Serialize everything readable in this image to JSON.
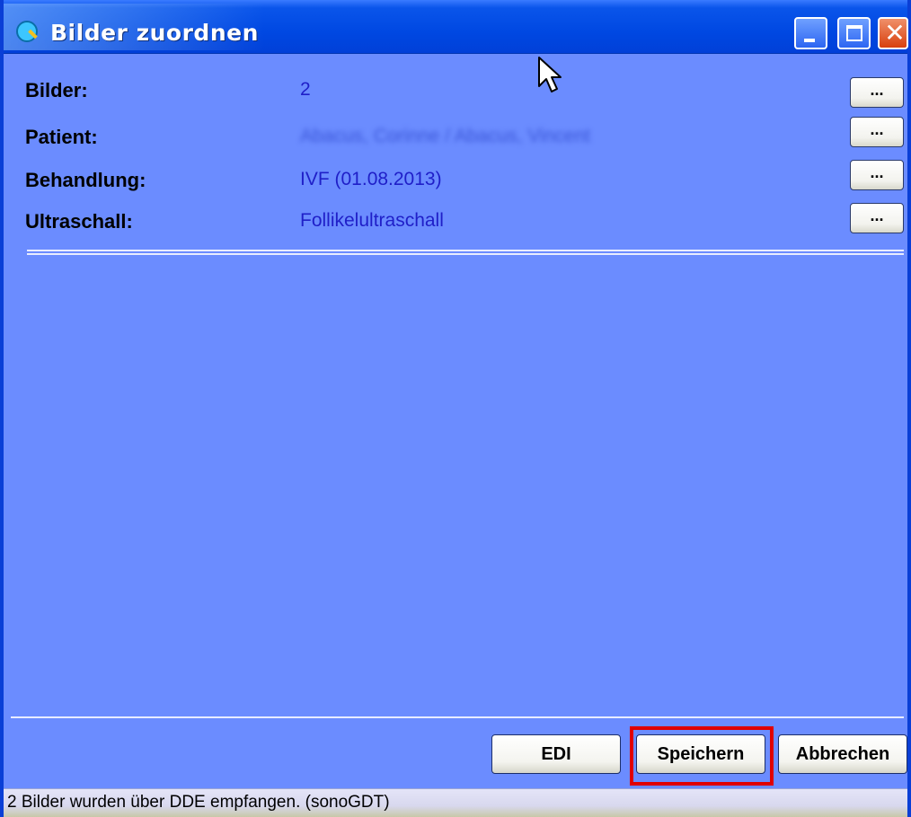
{
  "window": {
    "title": "Bilder zuordnen"
  },
  "fields": [
    {
      "label": "Bilder:",
      "value": "2",
      "button": "..."
    },
    {
      "label": "Patient:",
      "value": "Abacus, Corinne / Abacus, Vincent",
      "button": "..."
    },
    {
      "label": "Behandlung:",
      "value": "IVF  (01.08.2013)",
      "button": "..."
    },
    {
      "label": "Ultraschall:",
      "value": "Follikelultraschall",
      "button": "..."
    }
  ],
  "actions": {
    "edi_label": "EDI",
    "save_label": "Speichern",
    "cancel_label": "Abbrechen"
  },
  "status": {
    "text": "2 Bilder wurden über DDE empfangen. (sonoGDT)"
  },
  "colors": {
    "client_bg": "#6b8cff",
    "value_text": "#1f1fc8",
    "highlight_border": "#e00000"
  }
}
